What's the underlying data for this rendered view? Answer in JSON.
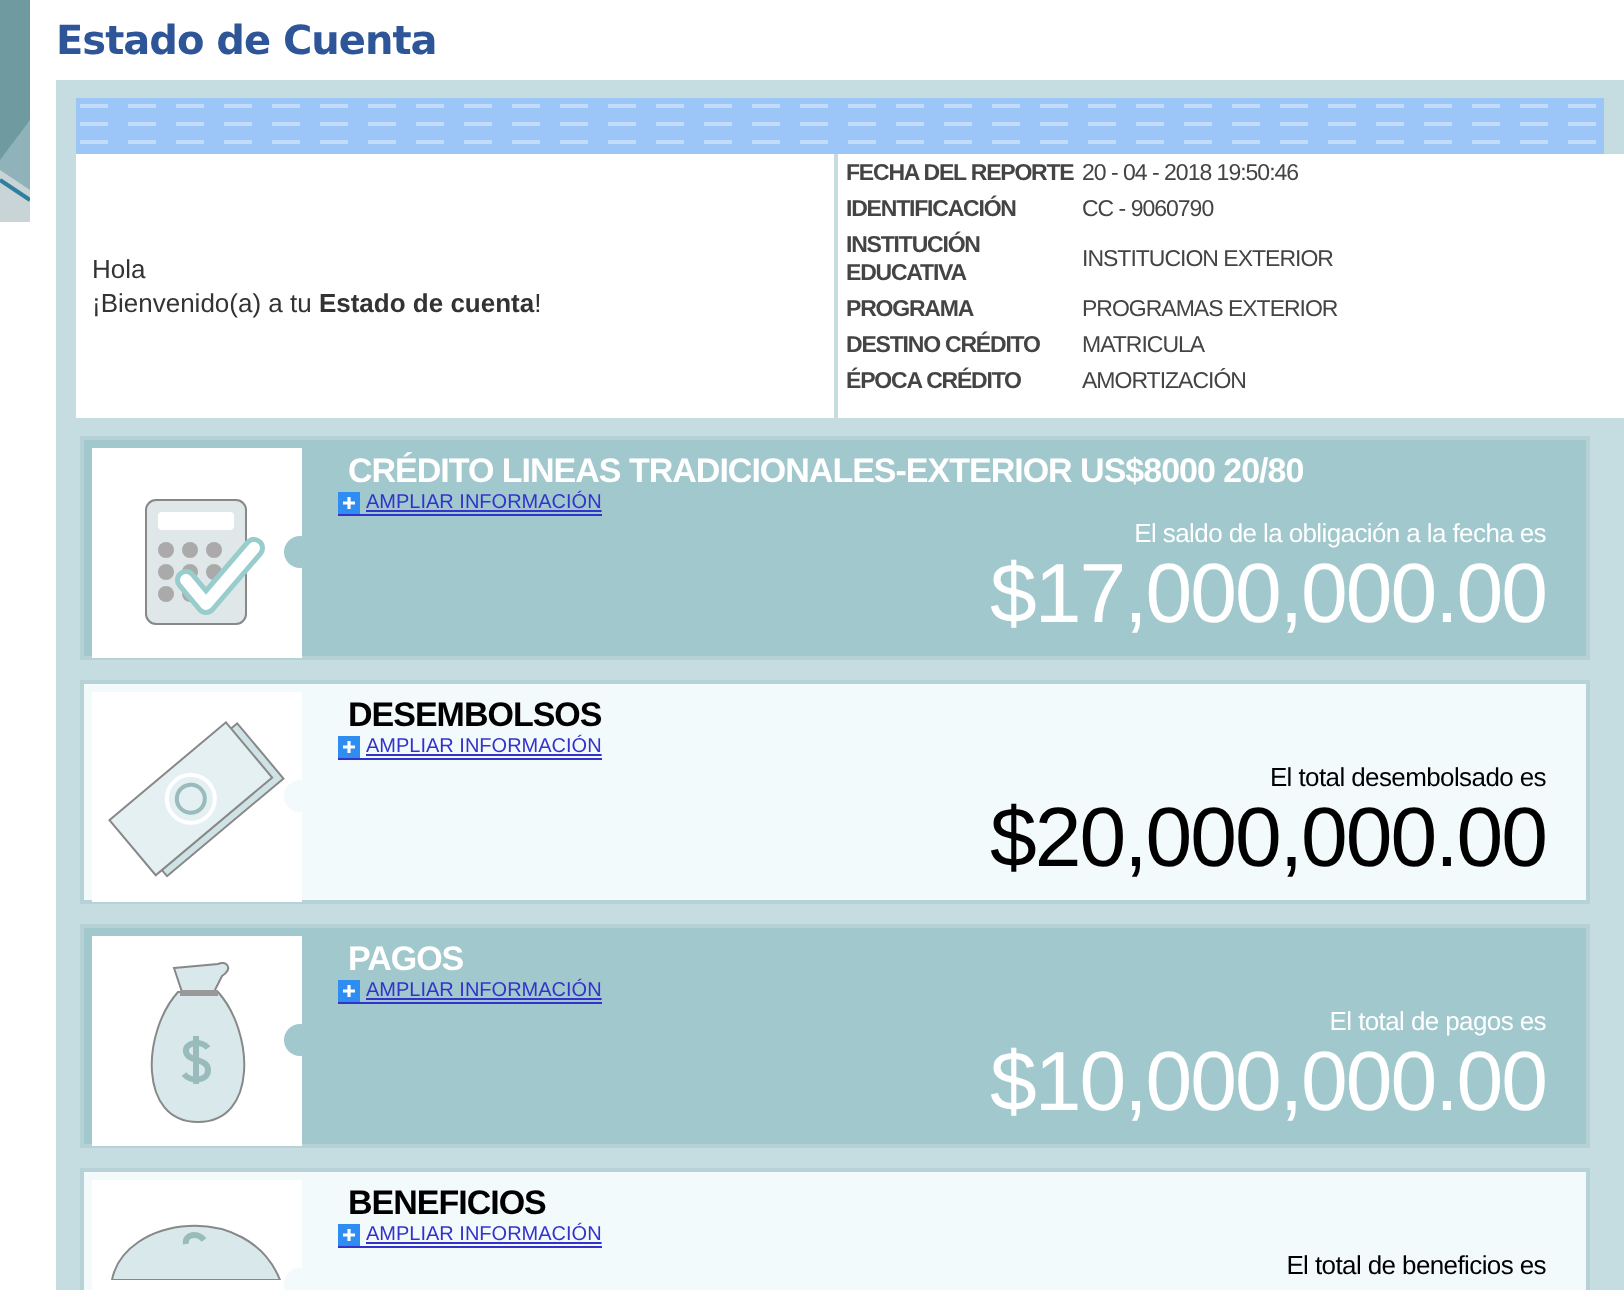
{
  "page_title": "Estado de Cuenta",
  "greeting": {
    "line_1": "Hola",
    "line_2": "¡Bienvenido(a) a tu **Estado de cuenta**!"
  },
  "report_info": [
    {
      "label": "FECHA DEL REPORTE",
      "value": "20 - 04 - 2018 19:50:46"
    },
    {
      "label": "IDENTIFICACIÓN",
      "value": "CC - 9060790"
    },
    {
      "label": "INSTITUCIÓN EDUCATIVA",
      "value": "INSTITUCION EXTERIOR"
    },
    {
      "label": "PROGRAMA",
      "value": "PROGRAMAS EXTERIOR"
    },
    {
      "label": "DESTINO CRÉDITO",
      "value": "MATRICULA"
    },
    {
      "label": "ÉPOCA CRÉDITO",
      "value": "AMORTIZACIÓN"
    }
  ],
  "cards": [
    {
      "kind": "dark",
      "title": "CRÉDITO LINEAS TRADICIONALES-EXTERIOR US$8000 20/80",
      "link": "AMPLIAR INFORMACIÓN",
      "caption": "El saldo de la obligación a la fecha es",
      "amount": "$17,000,000.00"
    },
    {
      "kind": "light",
      "title": "DESEMBOLSOS",
      "link": "AMPLIAR INFORMACIÓN",
      "caption": "El total desembolsado es",
      "amount": "$20,000,000.00"
    },
    {
      "kind": "dark",
      "title": "PAGOS",
      "link": "AMPLIAR INFORMACIÓN",
      "caption": "El total de pagos es",
      "amount": "$10,000,000.00"
    },
    {
      "kind": "light",
      "title": "BENEFICIOS",
      "link": "AMPLIAR INFORMACIÓN",
      "caption": "El total de beneficios es"
    }
  ]
}
